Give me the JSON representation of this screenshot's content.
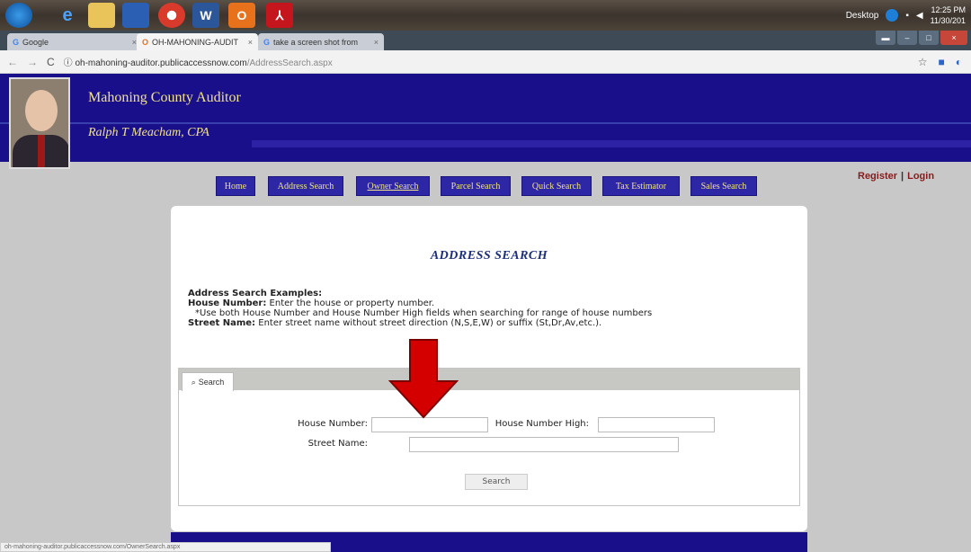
{
  "taskbar": {
    "apps": [
      "Chrome",
      "IE",
      "Explorer",
      "Outlook",
      "Chrome",
      "Word",
      "Office",
      "Acrobat"
    ],
    "tray_label": "Desktop",
    "time": "12:25 PM",
    "date": "11/30/201"
  },
  "browser": {
    "tabs": [
      {
        "label": "Google",
        "favicon": "G"
      },
      {
        "label": "OH-MAHONING-AUDIT",
        "favicon": "O"
      },
      {
        "label": "take a screen shot from",
        "favicon": "G"
      }
    ],
    "url_host": "oh-mahoning-auditor.publicaccessnow.com",
    "url_path": "/AddressSearch.aspx"
  },
  "header": {
    "title": "Mahoning County Auditor",
    "subtitle": "Ralph T Meacham, CPA"
  },
  "nav": {
    "items": [
      "Home",
      "Address Search",
      "Owner Search",
      "Parcel Search",
      "Quick Search",
      "Tax Estimator",
      "Sales Search"
    ],
    "register": "Register",
    "separator": "|",
    "login": "Login"
  },
  "main": {
    "title": "ADDRESS SEARCH",
    "examples_heading": "Address Search Examples:",
    "house_number_label": "House Number:",
    "house_number_text": "Enter the house or property number.",
    "range_note": "*Use both House Number and House Number High fields when searching for range of house numbers",
    "street_name_label": "Street Name:",
    "street_name_text": "Enter street name without street direction (N,S,E,W) or suffix (St,Dr,Av,etc.).",
    "tab_label": "Search",
    "form": {
      "house_number": "House Number:",
      "house_number_high": "House Number High:",
      "street_name": "Street Name:",
      "house_number_value": "",
      "house_number_high_value": "",
      "street_name_value": "",
      "search_button": "Search"
    }
  },
  "status_url": "oh-mahoning-auditor.publicaccessnow.com/OwnerSearch.aspx",
  "colors": {
    "header_blue": "#1a0f8a",
    "header_text": "#f2e48a",
    "title_blue": "#1d2f7a",
    "arrow_red": "#d40000"
  }
}
